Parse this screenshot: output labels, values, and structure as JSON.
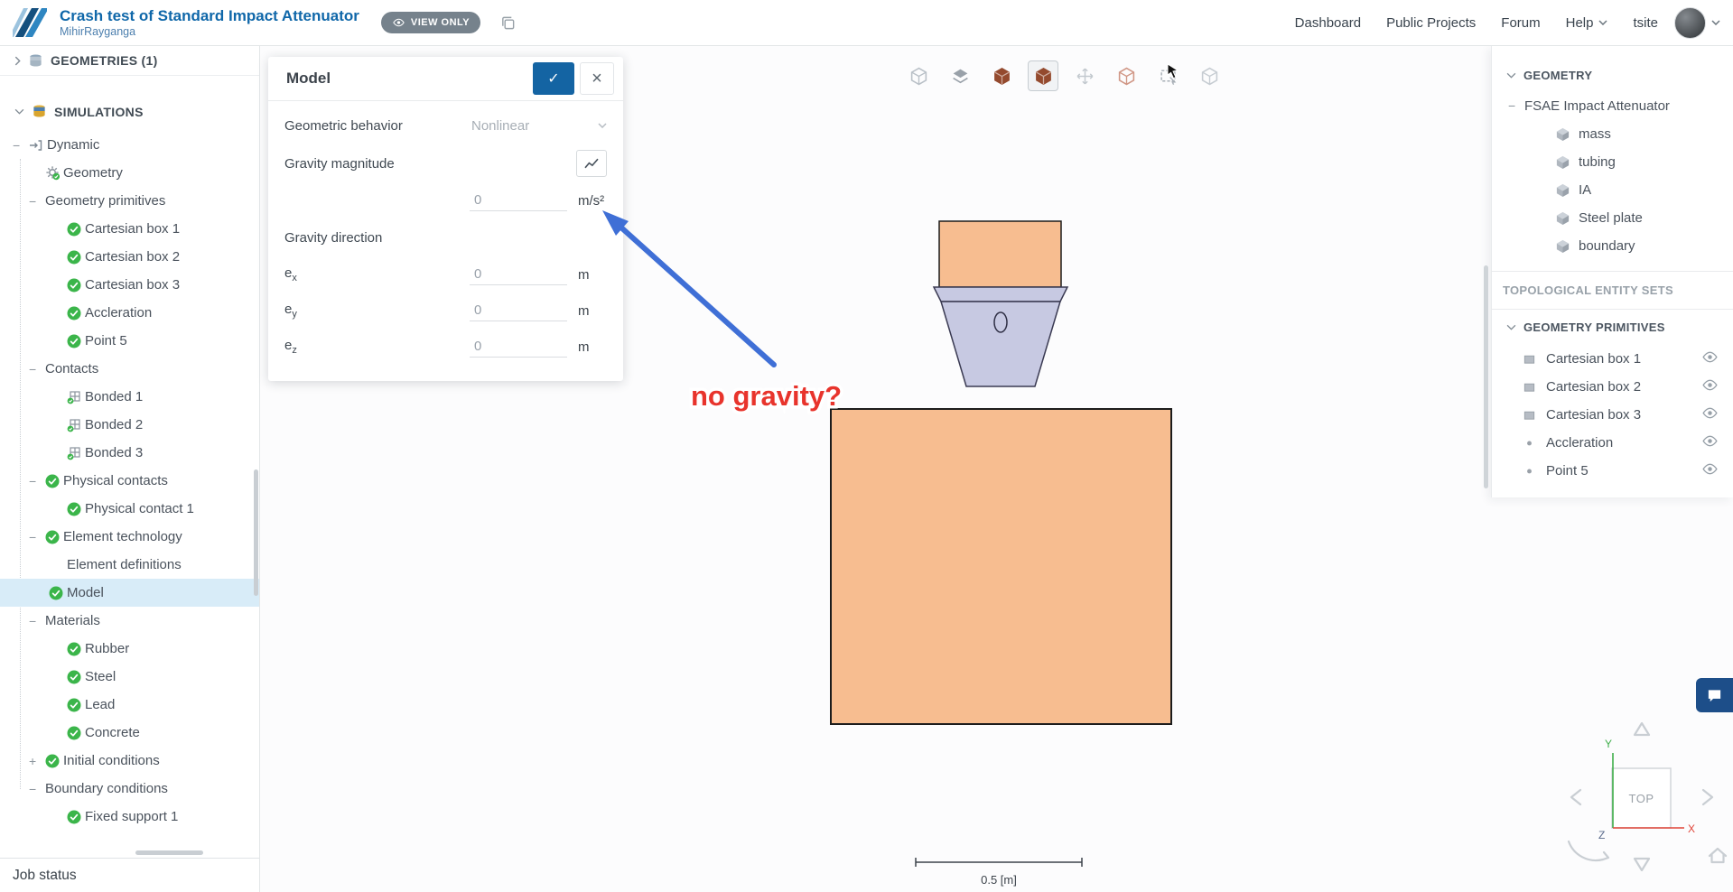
{
  "colors": {
    "accent_blue": "#1464a3",
    "link_blue": "#0f67a9",
    "success_green": "#3bb54a",
    "selected_row": "#d8ecf8",
    "attenuator_orange": "#f7bd90",
    "impactor_lavender": "#c7c9e2",
    "annotation_arrow_blue": "#3f6fd6",
    "annotation_red": "#e8342c"
  },
  "header": {
    "project_title": "Crash test of Standard Impact Attenuator",
    "project_owner": "MihirRayganga",
    "view_only_label": "VIEW ONLY",
    "nav_items": [
      {
        "label": "Dashboard",
        "caret": false
      },
      {
        "label": "Public Projects",
        "caret": false
      },
      {
        "label": "Forum",
        "caret": false
      },
      {
        "label": "Help",
        "caret": true
      },
      {
        "label": "tsite",
        "caret": false
      }
    ]
  },
  "sidebar": {
    "geometries_header": "GEOMETRIES (1)",
    "simulations_header": "SIMULATIONS",
    "job_status_label": "Job status",
    "tree": [
      {
        "label": "Dynamic",
        "level": 0,
        "expander": "minus",
        "icon": "dynamic",
        "selected": false
      },
      {
        "label": "Geometry",
        "level": 1,
        "expander": "none",
        "icon": "gear",
        "selected": false
      },
      {
        "label": "Geometry primitives",
        "level": 1,
        "expander": "minus",
        "icon": null,
        "selected": false
      },
      {
        "label": "Cartesian box 1",
        "level": 3,
        "expander": null,
        "icon": "check",
        "selected": false
      },
      {
        "label": "Cartesian box 2",
        "level": 3,
        "expander": null,
        "icon": "check",
        "selected": false
      },
      {
        "label": "Cartesian box 3",
        "level": 3,
        "expander": null,
        "icon": "check",
        "selected": false
      },
      {
        "label": "Accleration",
        "level": 3,
        "expander": null,
        "icon": "check",
        "selected": false
      },
      {
        "label": "Point 5",
        "level": 3,
        "expander": null,
        "icon": "check",
        "selected": false
      },
      {
        "label": "Contacts",
        "level": 1,
        "expander": "minus",
        "icon": null,
        "selected": false
      },
      {
        "label": "Bonded 1",
        "level": 3,
        "expander": null,
        "icon": "bonded",
        "selected": false
      },
      {
        "label": "Bonded 2",
        "level": 3,
        "expander": null,
        "icon": "bonded",
        "selected": false
      },
      {
        "label": "Bonded 3",
        "level": 3,
        "expander": null,
        "icon": "bonded",
        "selected": false
      },
      {
        "label": "Physical contacts",
        "level": 1,
        "expander": "minus",
        "icon": "check",
        "selected": false
      },
      {
        "label": "Physical contact 1",
        "level": 3,
        "expander": null,
        "icon": "check",
        "selected": false
      },
      {
        "label": "Element technology",
        "level": 1,
        "expander": "minus",
        "icon": "check",
        "selected": false
      },
      {
        "label": "Element definitions",
        "level": 2,
        "expander": null,
        "icon": "blank",
        "selected": false
      },
      {
        "label": "Model",
        "level": 2,
        "expander": null,
        "icon": "check",
        "selected": true
      },
      {
        "label": "Materials",
        "level": 1,
        "expander": "minus",
        "icon": null,
        "selected": false
      },
      {
        "label": "Rubber",
        "level": 3,
        "expander": null,
        "icon": "check",
        "selected": false
      },
      {
        "label": "Steel",
        "level": 3,
        "expander": null,
        "icon": "check",
        "selected": false
      },
      {
        "label": "Lead",
        "level": 3,
        "expander": null,
        "icon": "check",
        "selected": false
      },
      {
        "label": "Concrete",
        "level": 3,
        "expander": null,
        "icon": "check",
        "selected": false
      },
      {
        "label": "Initial conditions",
        "level": 1,
        "expander": "plus",
        "icon": "check",
        "selected": false
      },
      {
        "label": "Boundary conditions",
        "level": 1,
        "expander": "minus",
        "icon": null,
        "selected": false
      },
      {
        "label": "Fixed support 1",
        "level": 3,
        "expander": null,
        "icon": "check",
        "selected": false
      }
    ]
  },
  "model_panel": {
    "title": "Model",
    "geometric_behavior_label": "Geometric behavior",
    "geometric_behavior_value": "Nonlinear",
    "gravity_magnitude_label": "Gravity magnitude",
    "gravity_magnitude_value": "0",
    "gravity_magnitude_unit": "m/s²",
    "gravity_direction_label": "Gravity direction",
    "direction_components": [
      {
        "base": "e",
        "sub": "x",
        "value": "0",
        "unit": "m"
      },
      {
        "base": "e",
        "sub": "y",
        "value": "0",
        "unit": "m"
      },
      {
        "base": "e",
        "sub": "z",
        "value": "0",
        "unit": "m"
      }
    ]
  },
  "viewport": {
    "toolbar": [
      {
        "name": "fit-view",
        "kind": "cube",
        "color": "#b9c0c7",
        "selected": false
      },
      {
        "name": "section-view",
        "kind": "layers",
        "color": "#99a1a9",
        "selected": false
      },
      {
        "name": "solid-view",
        "kind": "cube-solid",
        "color": "#944a2e",
        "selected": false
      },
      {
        "name": "textured-view",
        "kind": "cube-solid",
        "color": "#944a2e",
        "selected": true
      },
      {
        "name": "pan-view",
        "kind": "move",
        "color": "#c3c9cf",
        "selected": false
      },
      {
        "name": "wireframe-view",
        "kind": "cube",
        "color": "#d09685",
        "selected": false
      },
      {
        "name": "box-select",
        "kind": "select",
        "color": "#a8afb6",
        "selected": false
      },
      {
        "name": "visibility-options",
        "kind": "cube",
        "color": "#c6ccd2",
        "selected": false
      }
    ],
    "annotation_text": "no gravity?",
    "scale_label": "0.5 [m]",
    "nav_cube": {
      "face": "TOP",
      "x": "X",
      "y": "Y",
      "z": "Z"
    }
  },
  "right_panel": {
    "geometry_header": "GEOMETRY",
    "geometry_root": {
      "label": "FSAE Impact Attenuator",
      "expander": "minus"
    },
    "geometry_parts": [
      "mass",
      "tubing",
      "IA",
      "Steel plate",
      "boundary"
    ],
    "topological_header": "TOPOLOGICAL ENTITY SETS",
    "primitives_header": "GEOMETRY PRIMITIVES",
    "primitives": [
      {
        "label": "Cartesian box 1",
        "icon": "box"
      },
      {
        "label": "Cartesian box 2",
        "icon": "box"
      },
      {
        "label": "Cartesian box 3",
        "icon": "box"
      },
      {
        "label": "Accleration",
        "icon": "point"
      },
      {
        "label": "Point 5",
        "icon": "point"
      }
    ]
  }
}
